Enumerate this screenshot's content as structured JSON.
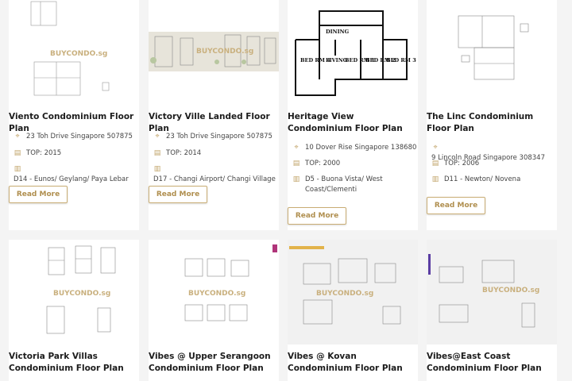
{
  "cards_row1": [
    {
      "title": "Viento Condominium Floor Plan",
      "address": "23 Toh Drive Singapore 507875",
      "top": "TOP: 2015",
      "district": "D14 - Eunos/ Geylang/ Paya Lebar",
      "button": "Read More"
    },
    {
      "title": "Victory Ville Landed Floor Plan",
      "address": "23 Toh Drive Singapore 507875",
      "top": "TOP: 2014",
      "district": "D17 - Changi Airport/ Changi Village",
      "button": "Read More"
    },
    {
      "title": "Heritage View Condominium Floor Plan",
      "address": "10 Dover Rise Singapore 138680",
      "top": "TOP: 2000",
      "district": "D5 - Buona Vista/ West Coast/Clementi",
      "button": "Read More"
    },
    {
      "title": "The Linc Condominium Floor Plan",
      "address": "9 Lincoln Road Singapore 308347",
      "top": "TOP: 2006",
      "district": "D11 - Newton/ Novena",
      "button": "Read More"
    }
  ],
  "cards_row2": [
    {
      "title": "Victoria Park Villas Condominium Floor Plan"
    },
    {
      "title": "Vibes @ Upper Serangoon Condominium Floor Plan"
    },
    {
      "title": "Vibes @ Kovan Condominium Floor Plan"
    },
    {
      "title": "Vibes@East Coast Condominium Floor Plan"
    }
  ],
  "watermark": "BUYCONDO.sg",
  "plan_labels": {
    "dining": "DINING",
    "living": "LIVING",
    "bed_rm_4": "BED RM 4",
    "bed_rm_1": "BED RM 1",
    "bed_rm_2": "BED RM 2",
    "bed_rm_3": "BED RM 3"
  },
  "icons": {
    "address": "map-pin-icon",
    "top": "calendar-icon",
    "district": "building-icon"
  },
  "colors": {
    "accent": "#c2a46a",
    "button_text": "#b08f4f",
    "background": "#f4f4f4"
  }
}
